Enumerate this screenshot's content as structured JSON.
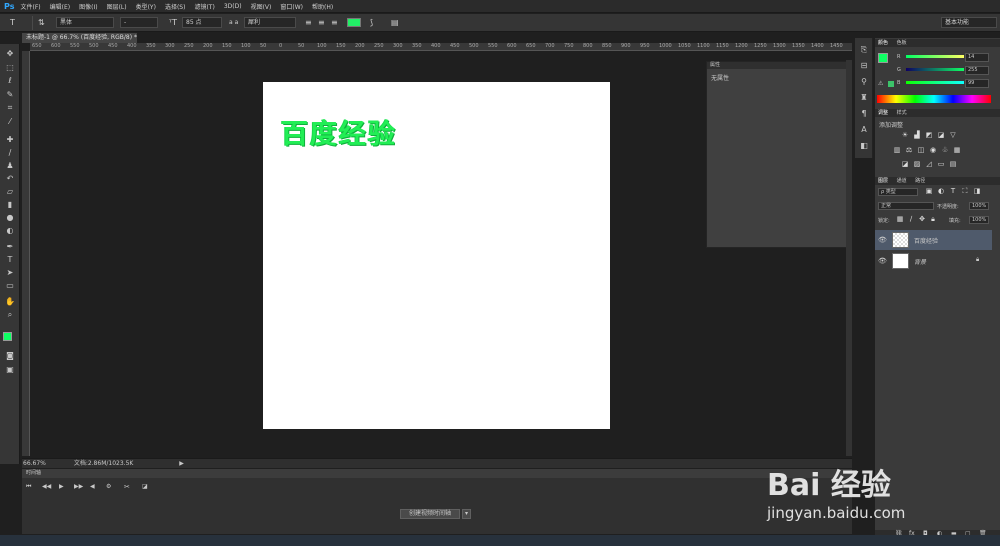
{
  "app": {
    "logo": "Ps"
  },
  "menu": [
    "文件(F)",
    "编辑(E)",
    "图像(I)",
    "图层(L)",
    "类型(Y)",
    "选择(S)",
    "滤镜(T)",
    "3D(D)",
    "视图(V)",
    "窗口(W)",
    "帮助(H)"
  ],
  "options": {
    "font_family": "黑体",
    "font_style": "-",
    "font_size": "85 点",
    "aa_label": "a a",
    "antialias": "犀利",
    "text_color": "#22ee66",
    "workspace": "基本功能"
  },
  "document": {
    "tab_title": "未标题-1 @ 66.7% (百度经验, RGB/8) *",
    "canvas_text": "百度经验",
    "zoom": "66.67%",
    "doc_info": "文档:2.86M/1023.5K"
  },
  "ruler_top": [
    "650",
    "600",
    "550",
    "500",
    "450",
    "400",
    "350",
    "300",
    "250",
    "200",
    "150",
    "100",
    "50",
    "0",
    "50",
    "100",
    "150",
    "200",
    "250",
    "300",
    "350",
    "400",
    "450",
    "500",
    "550",
    "600",
    "650",
    "700",
    "750",
    "800",
    "850",
    "900",
    "950",
    "1000",
    "1050",
    "1100",
    "1150",
    "1200",
    "1250",
    "1300",
    "1350",
    "1400",
    "1450"
  ],
  "properties_panel": {
    "title": "属性",
    "body": "无属性"
  },
  "timeline": {
    "title": "时间轴",
    "create_button": "创建视频时间轴"
  },
  "color_panel": {
    "tabs": [
      "颜色",
      "色板"
    ],
    "r_label": "R",
    "g_label": "G",
    "b_label": "B",
    "r": "14",
    "g": "255",
    "b": "99",
    "fg_color": "#0eff63"
  },
  "adjust_panel": {
    "tabs": [
      "调整",
      "样式"
    ],
    "title": "添加调整"
  },
  "layers_panel": {
    "tabs": [
      "图层",
      "通道",
      "路径"
    ],
    "filter_label": "ρ 类型",
    "blend_mode": "正常",
    "opacity_label": "不透明度:",
    "opacity": "100%",
    "lock_label": "锁定:",
    "fill_label": "填充:",
    "fill": "100%",
    "layers": [
      {
        "name": "百度经验"
      },
      {
        "name": "背景"
      }
    ]
  },
  "watermark": {
    "brand": "Bai 经验",
    "url": "jingyan.baidu.com"
  }
}
